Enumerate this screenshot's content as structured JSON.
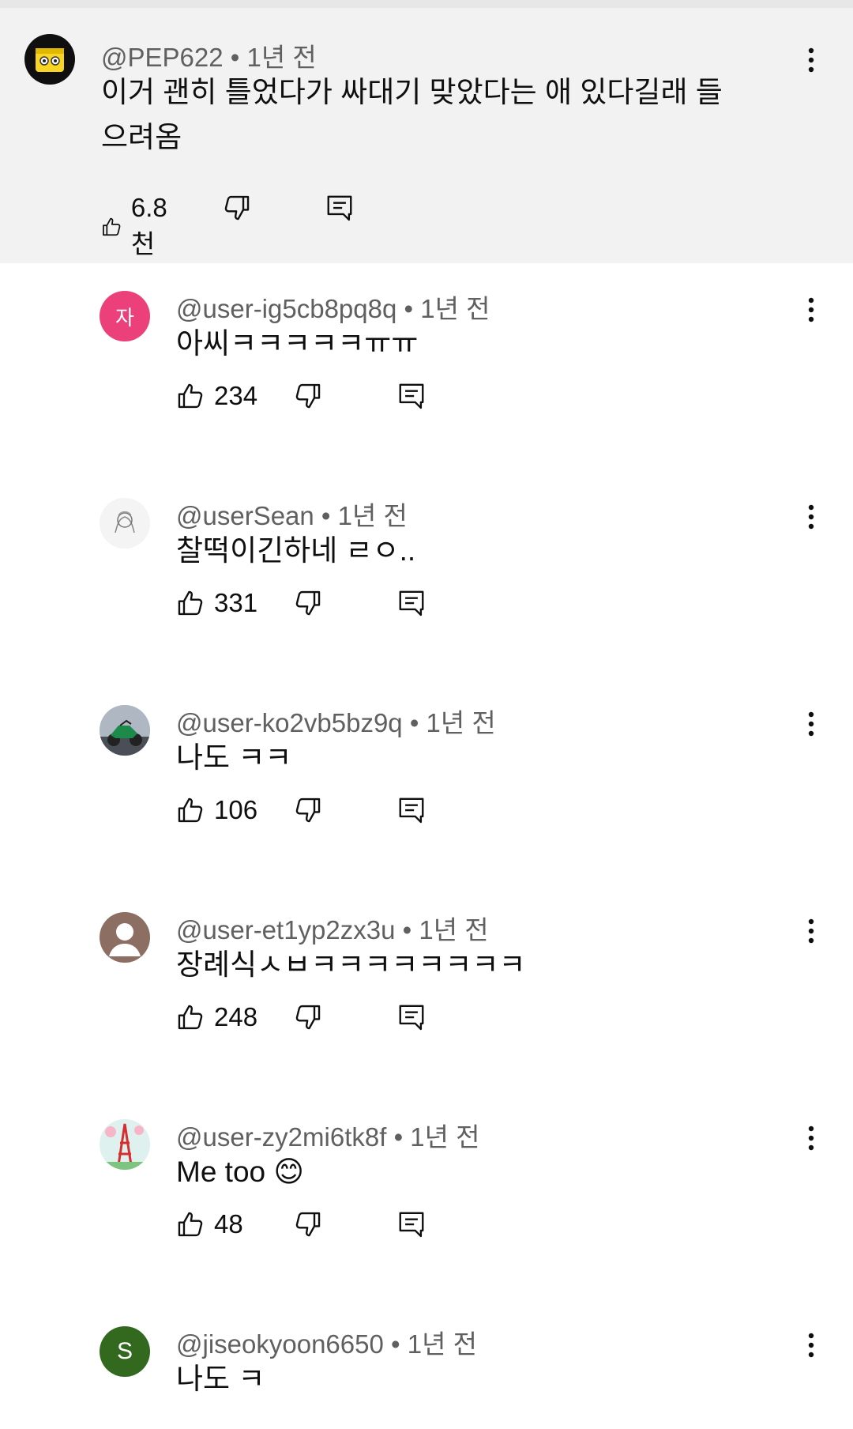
{
  "parent": {
    "username": "@PEP622",
    "time": "1년 전",
    "text": "이거 괜히 틀었다가 싸대기 맞았다는 애 있다길래 들으려옴",
    "likes": "6.8천"
  },
  "separator": " • ",
  "replies": [
    {
      "username": "@user-ig5cb8pq8q",
      "time": "1년 전",
      "text": "아씨ㅋㅋㅋㅋㅋㅠㅠ",
      "likes": "234",
      "avatar_letter": "자",
      "avatar_color": "#ec407a"
    },
    {
      "username": "@userSean",
      "time": "1년 전",
      "text": "찰떡이긴하네 ㄹㅇ..",
      "likes": "331"
    },
    {
      "username": "@user-ko2vb5bz9q",
      "time": "1년 전",
      "text": "나도 ㅋㅋ",
      "likes": "106"
    },
    {
      "username": "@user-et1yp2zx3u",
      "time": "1년 전",
      "text": "장례식ㅅㅂㅋㅋㅋㅋㅋㅋㅋㅋ",
      "likes": "248"
    },
    {
      "username": "@user-zy2mi6tk8f",
      "time": "1년 전",
      "text": "Me too 😊",
      "likes": "48"
    },
    {
      "username": "@jiseokyoon6650",
      "time": "1년 전",
      "text": "나도 ㅋ",
      "likes": "",
      "avatar_letter": "S",
      "avatar_color": "#33691e"
    }
  ]
}
